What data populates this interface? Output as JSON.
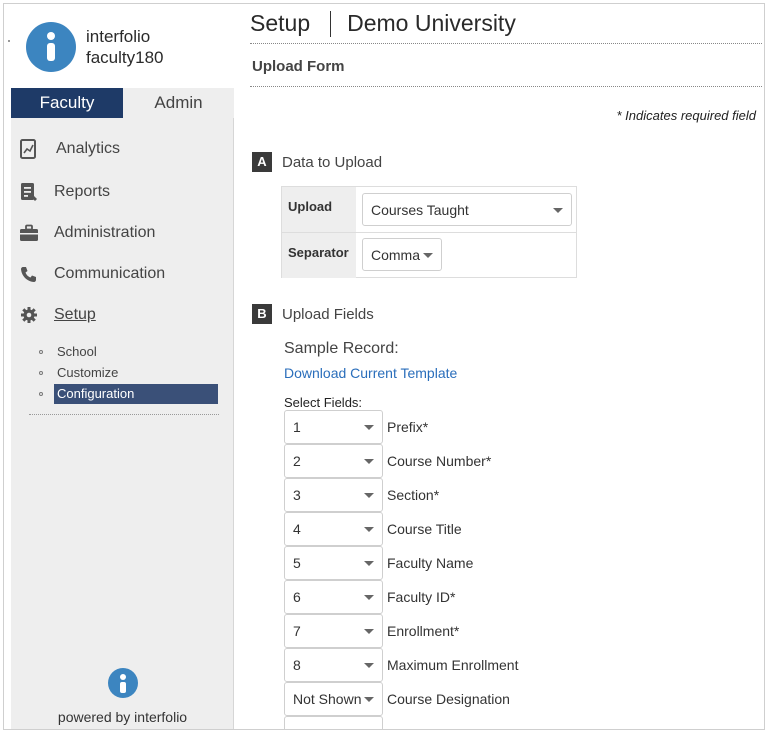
{
  "brand": {
    "line1": "interfolio",
    "line2": "faculty180"
  },
  "tabs": {
    "faculty": "Faculty",
    "admin": "Admin"
  },
  "nav": [
    {
      "label": "Analytics",
      "icon": "analytics-icon"
    },
    {
      "label": "Reports",
      "icon": "reports-icon"
    },
    {
      "label": "Administration",
      "icon": "briefcase-icon"
    },
    {
      "label": "Communication",
      "icon": "phone-icon"
    },
    {
      "label": "Setup",
      "icon": "gear-icon"
    }
  ],
  "subnav": [
    {
      "label": "School"
    },
    {
      "label": "Customize"
    },
    {
      "label": "Configuration",
      "active": true
    }
  ],
  "powered": "powered by interfolio",
  "header": {
    "title": "Setup",
    "org": "Demo University"
  },
  "form": {
    "title": "Upload Form",
    "required_note": "* Indicates required field",
    "section_a": {
      "badge": "A",
      "title": "Data to Upload"
    },
    "upload_label": "Upload",
    "upload_value": "Courses Taught",
    "separator_label": "Separator",
    "separator_value": "Comma",
    "section_b": {
      "badge": "B",
      "title": "Upload Fields"
    },
    "sample_record": "Sample Record:",
    "download_link": "Download Current Template",
    "select_fields": "Select Fields:"
  },
  "fields": [
    {
      "value": "1",
      "label": "Prefix*"
    },
    {
      "value": "2",
      "label": "Course Number*"
    },
    {
      "value": "3",
      "label": "Section*"
    },
    {
      "value": "4",
      "label": "Course Title"
    },
    {
      "value": "5",
      "label": "Faculty Name"
    },
    {
      "value": "6",
      "label": "Faculty ID*"
    },
    {
      "value": "7",
      "label": "Enrollment*"
    },
    {
      "value": "8",
      "label": "Maximum Enrollment"
    },
    {
      "value": "Not Shown",
      "label": "Course Designation"
    }
  ],
  "colors": {
    "brand_blue": "#3c85c0",
    "nav_active": "#1e3a67",
    "link": "#2a6ebb"
  }
}
